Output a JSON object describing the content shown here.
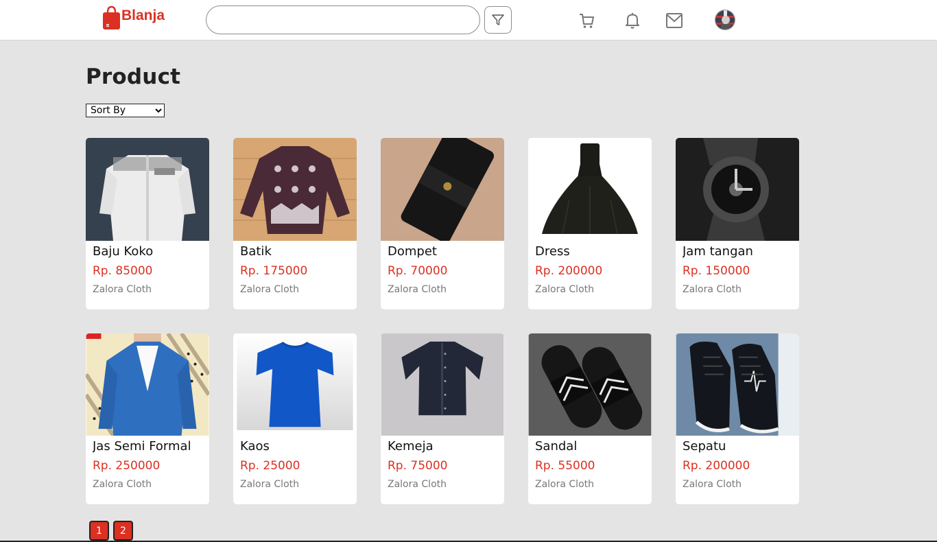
{
  "header": {
    "brand": "Blanja",
    "search": {
      "value": "",
      "placeholder": ""
    },
    "icons": [
      "filter-icon",
      "cart-icon",
      "bell-icon",
      "mail-icon",
      "avatar"
    ]
  },
  "main": {
    "title": "Product",
    "sort": {
      "selected": "Sort By",
      "options": [
        "Sort By"
      ]
    }
  },
  "products": [
    {
      "name": "Baju Koko",
      "price": "Rp. 85000",
      "store": "Zalora Cloth"
    },
    {
      "name": "Batik",
      "price": "Rp. 175000",
      "store": "Zalora Cloth"
    },
    {
      "name": "Dompet",
      "price": "Rp. 70000",
      "store": "Zalora Cloth"
    },
    {
      "name": "Dress",
      "price": "Rp. 200000",
      "store": "Zalora Cloth"
    },
    {
      "name": "Jam tangan",
      "price": "Rp. 150000",
      "store": "Zalora Cloth"
    },
    {
      "name": "Jas Semi Formal",
      "price": "Rp. 250000",
      "store": "Zalora Cloth"
    },
    {
      "name": "Kaos",
      "price": "Rp. 25000",
      "store": "Zalora Cloth"
    },
    {
      "name": "Kemeja",
      "price": "Rp. 75000",
      "store": "Zalora Cloth"
    },
    {
      "name": "Sandal",
      "price": "Rp. 55000",
      "store": "Zalora Cloth"
    },
    {
      "name": "Sepatu",
      "price": "Rp. 200000",
      "store": "Zalora Cloth"
    }
  ],
  "pagination": {
    "pages": [
      "1",
      "2"
    ]
  },
  "colors": {
    "accent": "#db3022",
    "background": "#e4e4e4"
  }
}
